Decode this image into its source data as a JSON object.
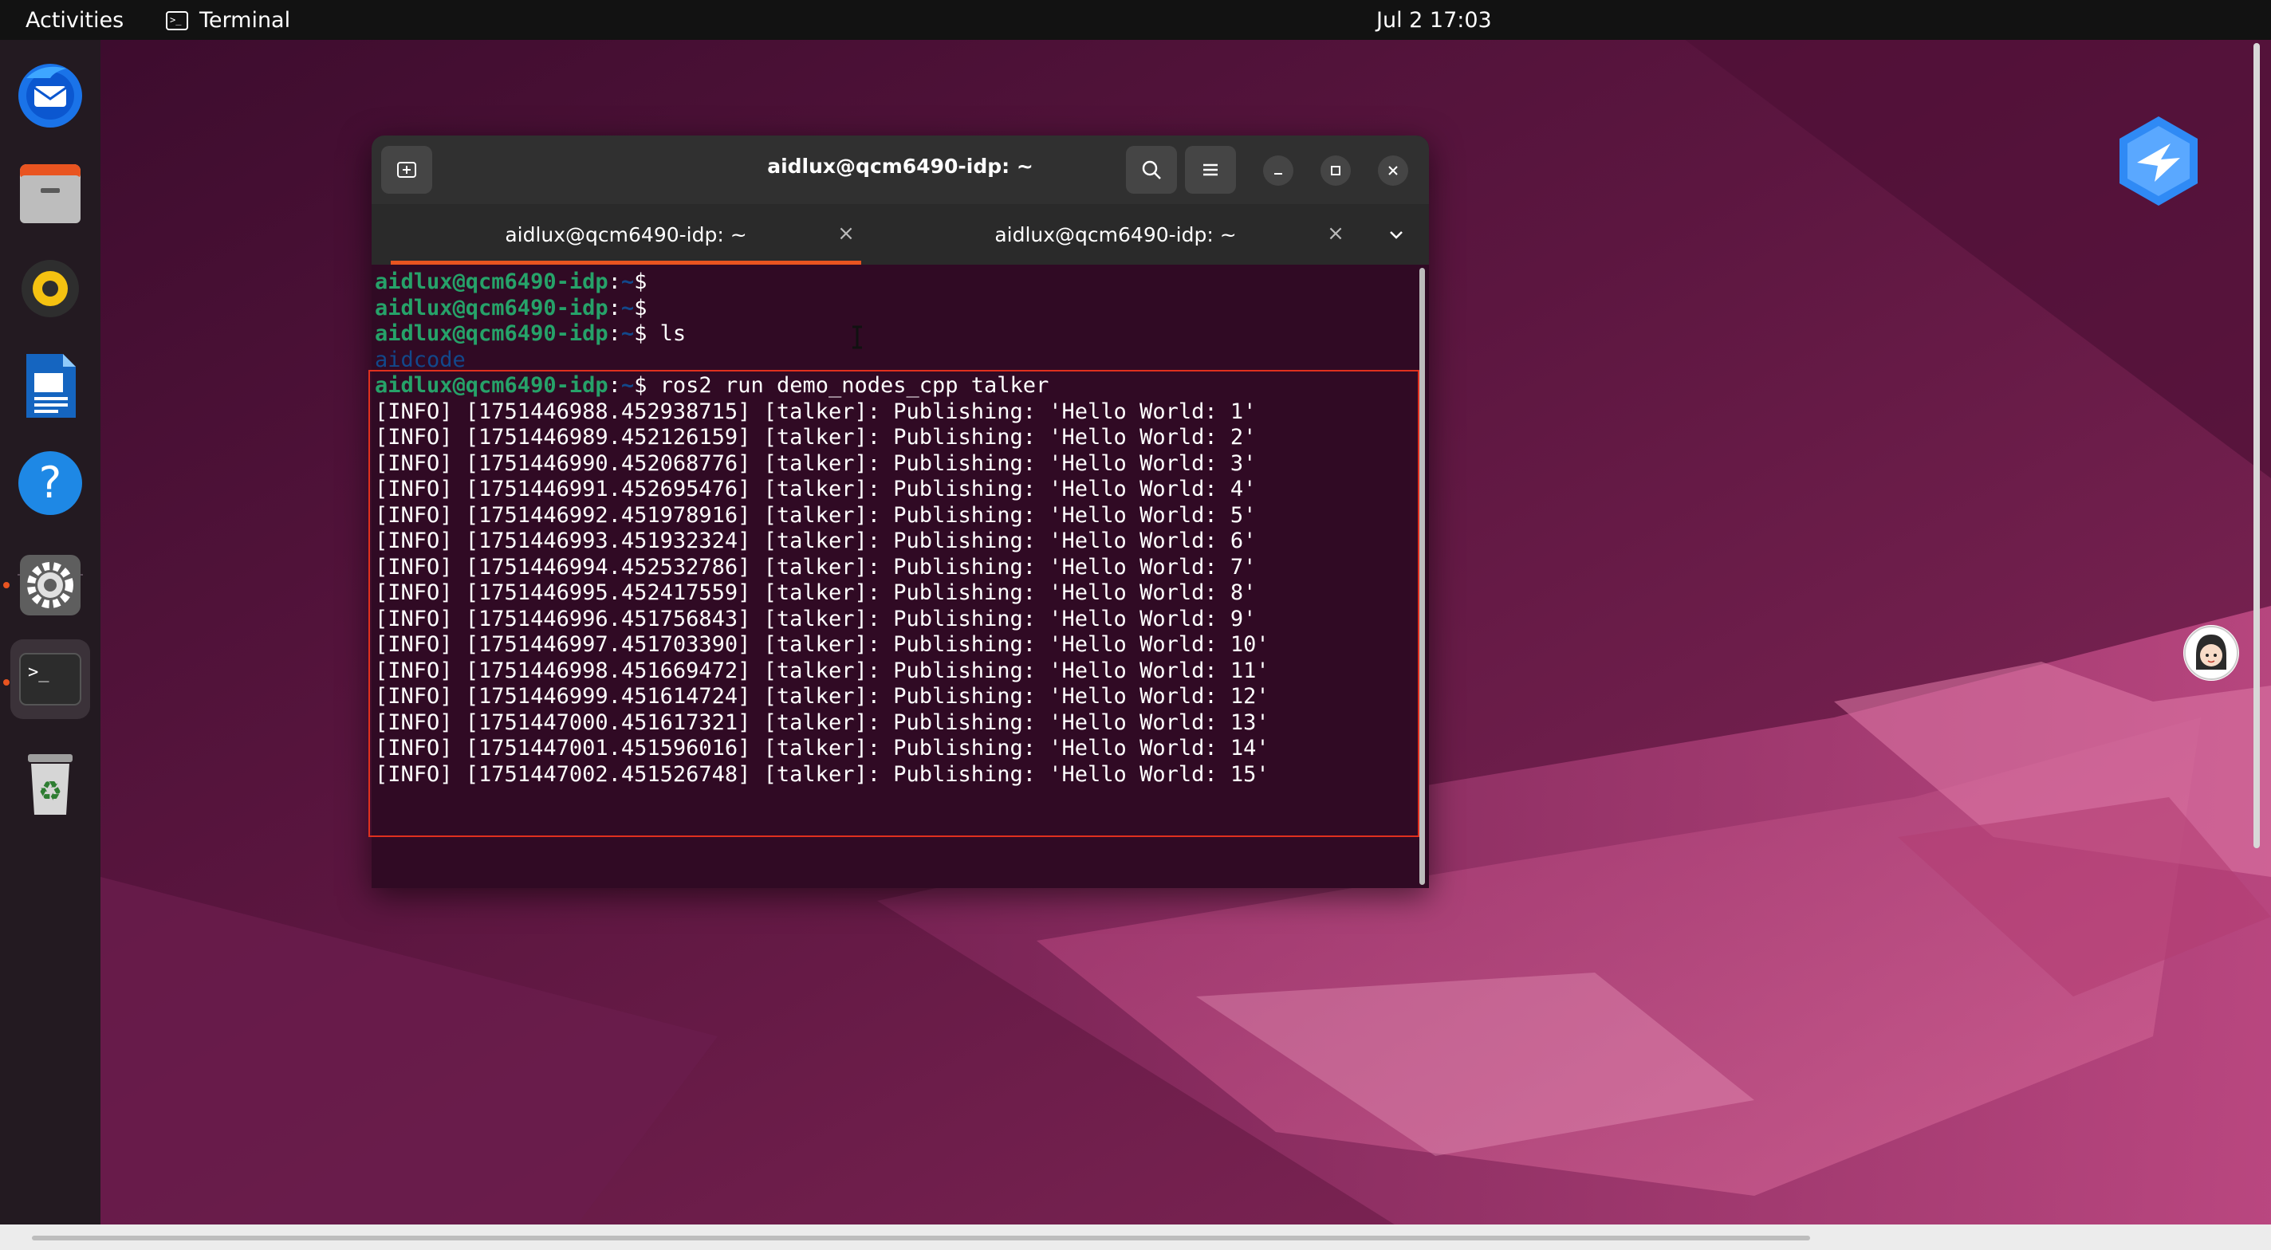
{
  "topbar": {
    "activities": "Activities",
    "app_name": "Terminal",
    "clock": "Jul 2  17:03"
  },
  "dock": {
    "items": [
      {
        "name": "thunderbird-icon"
      },
      {
        "name": "files-icon"
      },
      {
        "name": "rhythmbox-icon"
      },
      {
        "name": "writer-icon"
      },
      {
        "name": "help-icon"
      },
      {
        "name": "settings-icon",
        "running": true
      },
      {
        "name": "terminal-icon",
        "running": true,
        "active": true
      },
      {
        "name": "trash-icon"
      }
    ]
  },
  "terminal": {
    "title": "aidlux@qcm6490-idp: ~",
    "tabs": [
      {
        "label": "aidlux@qcm6490-idp: ~",
        "active": true
      },
      {
        "label": "aidlux@qcm6490-idp: ~",
        "active": false
      }
    ],
    "close_glyph": "×",
    "prompt_user": "aidlux@qcm6490-idp",
    "prompt_sep": ":",
    "prompt_path": "~",
    "prompt_char": "$",
    "lines": [
      {
        "type": "prompt",
        "cmd": ""
      },
      {
        "type": "prompt",
        "cmd": ""
      },
      {
        "type": "prompt",
        "cmd": " ls"
      },
      {
        "type": "dir",
        "text": "aidcode"
      },
      {
        "type": "prompt",
        "cmd": " ros2 run demo_nodes_cpp talker"
      },
      {
        "type": "out",
        "text": "[INFO] [1751446988.452938715] [talker]: Publishing: 'Hello World: 1'"
      },
      {
        "type": "out",
        "text": "[INFO] [1751446989.452126159] [talker]: Publishing: 'Hello World: 2'"
      },
      {
        "type": "out",
        "text": "[INFO] [1751446990.452068776] [talker]: Publishing: 'Hello World: 3'"
      },
      {
        "type": "out",
        "text": "[INFO] [1751446991.452695476] [talker]: Publishing: 'Hello World: 4'"
      },
      {
        "type": "out",
        "text": "[INFO] [1751446992.451978916] [talker]: Publishing: 'Hello World: 5'"
      },
      {
        "type": "out",
        "text": "[INFO] [1751446993.451932324] [talker]: Publishing: 'Hello World: 6'"
      },
      {
        "type": "out",
        "text": "[INFO] [1751446994.452532786] [talker]: Publishing: 'Hello World: 7'"
      },
      {
        "type": "out",
        "text": "[INFO] [1751446995.452417559] [talker]: Publishing: 'Hello World: 8'"
      },
      {
        "type": "out",
        "text": "[INFO] [1751446996.451756843] [talker]: Publishing: 'Hello World: 9'"
      },
      {
        "type": "out",
        "text": "[INFO] [1751446997.451703390] [talker]: Publishing: 'Hello World: 10'"
      },
      {
        "type": "out",
        "text": "[INFO] [1751446998.451669472] [talker]: Publishing: 'Hello World: 11'"
      },
      {
        "type": "out",
        "text": "[INFO] [1751446999.451614724] [talker]: Publishing: 'Hello World: 12'"
      },
      {
        "type": "out",
        "text": "[INFO] [1751447000.451617321] [talker]: Publishing: 'Hello World: 13'"
      },
      {
        "type": "out",
        "text": "[INFO] [1751447001.451596016] [talker]: Publishing: 'Hello World: 14'"
      },
      {
        "type": "out",
        "text": "[INFO] [1751447002.451526748] [talker]: Publishing: 'Hello World: 15'"
      }
    ]
  },
  "colors": {
    "accent": "#e95420",
    "terminal_bg": "#300a24",
    "prompt_green": "#26a269",
    "prompt_blue": "#12488b",
    "highlight_red": "#e0301e"
  }
}
